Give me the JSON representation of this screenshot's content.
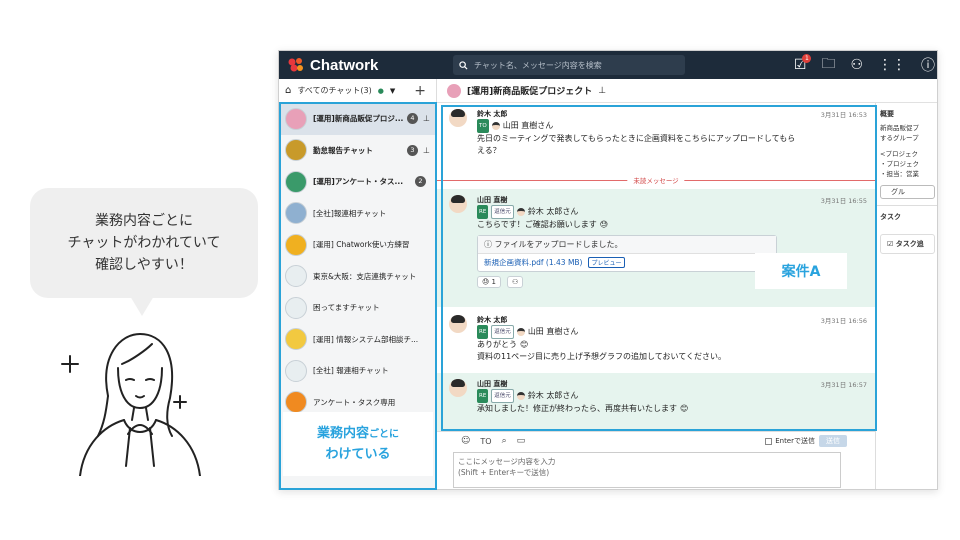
{
  "bubble": {
    "line1": "業務内容ごとに",
    "line2": "チャットがわかれていて",
    "line3": "確認しやすい！"
  },
  "app": {
    "logo": "Chatwork",
    "search_placeholder": "チャット名、メッセージ内容を検索",
    "task_badge": "1"
  },
  "sidebar": {
    "filter_label": "すべてのチャット(3)",
    "rooms": [
      {
        "name": "[運用]新商品販促プロジ...",
        "count": "4",
        "pinned": true,
        "active": true,
        "bold": true,
        "icon_color": "#e8a0b8"
      },
      {
        "name": "勤怠報告チャット",
        "count": "3",
        "pinned": true,
        "bold": true,
        "icon_color": "#c89a2a"
      },
      {
        "name": "[運用]アンケート・タス...",
        "count": "2",
        "bold": true,
        "icon_color": "#3a9a6a"
      },
      {
        "name": "[全社]報連相チャット",
        "icon_color": "#8fb0d0"
      },
      {
        "name": "[運用] Chatwork使い方練習",
        "icon_color": "#f0b020"
      },
      {
        "name": "東京&大阪：支店連携チャット",
        "icon_color": "#e8eef0"
      },
      {
        "name": "困ってますチャット",
        "icon_color": "#e8eef0"
      },
      {
        "name": "[運用] 情報システム部相談チ...",
        "icon_color": "#f2c940"
      },
      {
        "name": "[全社] 報連相チャット",
        "icon_color": "#e8eef0"
      },
      {
        "name": "アンケート・タスク専用",
        "icon_color": "#f08a20"
      }
    ]
  },
  "chat": {
    "title": "[運用]新商品販促プロジェクト",
    "unread_label": "未読メッセージ",
    "messages": [
      {
        "sender": "鈴木 太郎",
        "time": "3月31日 16:53",
        "to_tag": "TO",
        "to_name": "山田 直樹さん",
        "text1": "先日のミーティングで発表してもらったときに企画資料をこちらにアップロードしてもら",
        "text2": "える？"
      },
      {
        "sender": "山田 直樹",
        "time": "3月31日 16:55",
        "re_tag": "RE",
        "re_tag2": "返信元",
        "to_name": "鈴木 太郎さん",
        "text1": "こちらです！ご確認お願いします",
        "file_notice": "ⓘ ファイルをアップロードしました。",
        "file_name": "新規企画資料.pdf (1.43 MB)",
        "preview": "プレビュー",
        "react_count": "1"
      },
      {
        "sender": "鈴木 太郎",
        "time": "3月31日 16:56",
        "re_tag": "RE",
        "re_tag2": "返信元",
        "to_name": "山田 直樹さん",
        "text1": "ありがとう",
        "text2": "資料の11ページ目に売り上げ予想グラフの追加しておいてください。"
      },
      {
        "sender": "山田 直樹",
        "time": "3月31日 16:57",
        "re_tag": "RE",
        "re_tag2": "返信元",
        "to_name": "鈴木 太郎さん",
        "text1": "承知しました！修正が終わったら、再度共有いたします"
      }
    ]
  },
  "composer": {
    "to_label": "TO",
    "enter_label": "Enterで送信",
    "send_label": "送信",
    "placeholder1": "ここにメッセージ内容を入力",
    "placeholder2": "(Shift + Enterキーで送信)"
  },
  "right_panel": {
    "overview_head": "概要",
    "desc1": "新商品販促プ",
    "desc2": "するグループ",
    "proj1": "<プロジェク",
    "proj2": "・プロジェク",
    "proj3": "・担当：営業",
    "group_btn": "グル",
    "task_head": "タスク",
    "task_btn": "☑ タスク追"
  },
  "annotations": {
    "case_label": "案件A",
    "sidebar_label_big": "業務内容",
    "sidebar_label_small": "ごとに",
    "sidebar_label_line2": "わけている"
  },
  "colors": {
    "accent": "#29a3de",
    "topbar": "#1d2b3a",
    "highlight_row": "#e6f4ee"
  }
}
